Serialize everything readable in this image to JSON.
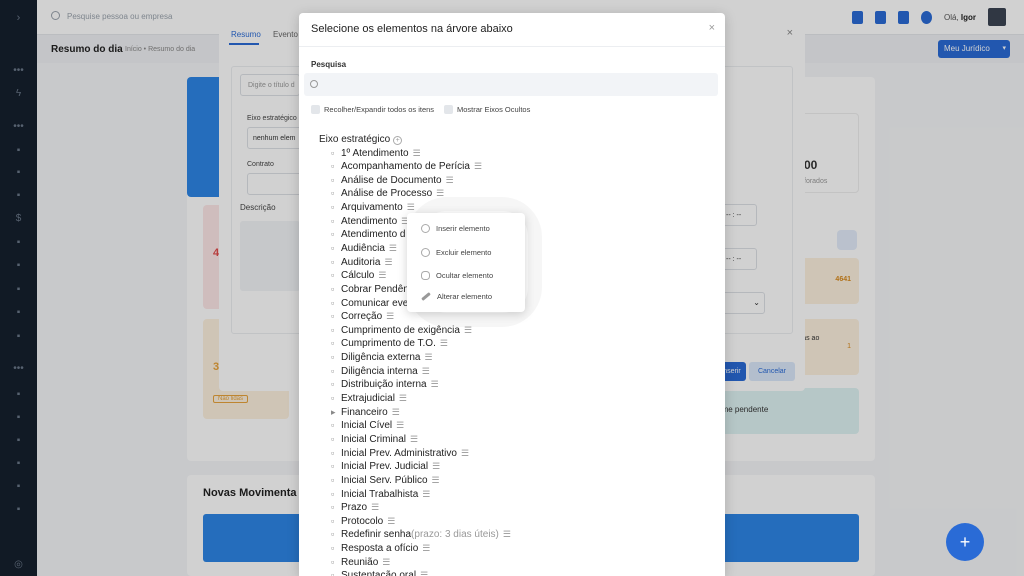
{
  "topbar": {
    "search_placeholder": "Pesquise pessoa ou empresa",
    "greeting": "Olá,",
    "username": "Igor"
  },
  "subheader": {
    "title": "Resumo do dia",
    "breadcrumb": "Início • Resumo do dia",
    "menu_button": "Meu Jurídico"
  },
  "dashboard": {
    "novas_title": "Novas Movimenta",
    "fab_label": "+",
    "kpi_value": "00",
    "kpi_label": "forados",
    "badge_value": "4641",
    "pending_label": "n nome pendente",
    "mimas_label": "mimas ao",
    "mimas_value": "1",
    "left_number_1": "4",
    "left_number_2": "3",
    "nao_lidas": "Não lidas"
  },
  "under_modal": {
    "tabs": [
      "Resumo",
      "Evento"
    ],
    "title_placeholder": "Digite o título d",
    "eixo_label": "Eixo estratégico",
    "eixo_value": "nenhum elem",
    "contrato_label": "Contrato",
    "descricao_label": "Descrição",
    "inserir": "Inserir",
    "cancelar": "Cancelar",
    "time_1": "-- : --",
    "time_2": "-- : --"
  },
  "modal": {
    "title": "Selecione os elementos na árvore abaixo",
    "close": "×",
    "search_label": "Pesquisa",
    "toggle_all": "Recolher/Expandir todos os itens",
    "show_hidden": "Mostrar Eixos Ocultos",
    "root": "Eixo estratégico",
    "items": [
      {
        "label": "1º Atendimento"
      },
      {
        "label": "Acompanhamento de Perícia"
      },
      {
        "label": "Análise de Documento"
      },
      {
        "label": "Análise de Processo"
      },
      {
        "label": "Arquivamento"
      },
      {
        "label": "Atendimento"
      },
      {
        "label": "Atendimento d"
      },
      {
        "label": "Audiência"
      },
      {
        "label": "Auditoria"
      },
      {
        "label": "Cálculo"
      },
      {
        "label": "Cobrar Pendên"
      },
      {
        "label": "Comunicar eve"
      },
      {
        "label": "Correção"
      },
      {
        "label": "Cumprimento de exigência"
      },
      {
        "label": "Cumprimento de T.O."
      },
      {
        "label": "Diligência externa"
      },
      {
        "label": "Diligência interna"
      },
      {
        "label": "Distribuição interna"
      },
      {
        "label": "Extrajudicial"
      },
      {
        "label": "Financeiro",
        "expandable": true
      },
      {
        "label": "Inicial Cível"
      },
      {
        "label": "Inicial Criminal"
      },
      {
        "label": "Inicial Prev. Administrativo"
      },
      {
        "label": "Inicial Prev. Judicial"
      },
      {
        "label": "Inicial Serv. Público"
      },
      {
        "label": "Inicial Trabalhista"
      },
      {
        "label": "Prazo"
      },
      {
        "label": "Protocolo"
      },
      {
        "label": "Redefinir senha",
        "extra": "(prazo: 3 dias úteis)"
      },
      {
        "label": "Resposta a ofício"
      },
      {
        "label": "Reunião"
      },
      {
        "label": "Sustentação oral"
      }
    ]
  },
  "context_menu": {
    "items": [
      {
        "label": "Inserir elemento",
        "icon": "plus-circle-icon"
      },
      {
        "label": "Excluir elemento",
        "icon": "minus-circle-icon"
      },
      {
        "label": "Ocultar elemento",
        "icon": "eye-slash-icon"
      },
      {
        "label": "Alterar elemento",
        "icon": "pencil-icon"
      }
    ]
  },
  "colors": {
    "primary": "#2a6bd6",
    "sidebar": "#15202e",
    "card_blue": "#2e86e6"
  }
}
